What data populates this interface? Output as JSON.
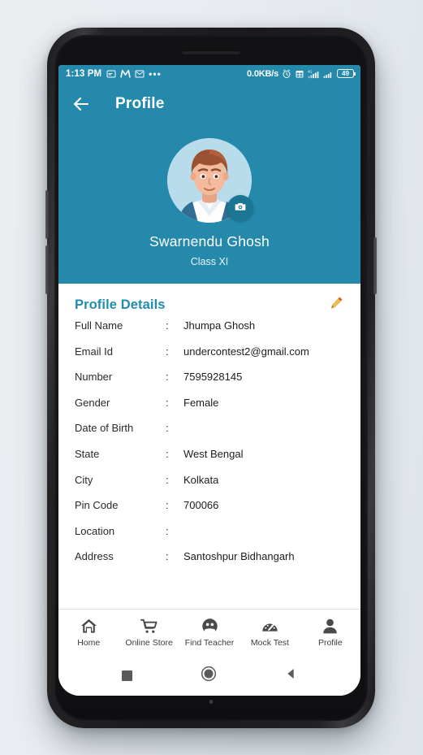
{
  "statusbar": {
    "time": "1:13 PM",
    "left_icons": [
      "message-icon",
      "m-app-icon",
      "gmail-icon",
      "overflow-dots-icon"
    ],
    "network_speed": "0.0KB/s",
    "right_icons": [
      "alarm-icon",
      "calendar-icon",
      "signal-4g-icon",
      "signal-icon"
    ],
    "battery_level": "49"
  },
  "appbar": {
    "back_label": "back-arrow",
    "title": "Profile"
  },
  "hero": {
    "avatar_alt": "user-avatar",
    "camera_button_label": "change-photo",
    "name": "Swarnendu Ghosh",
    "class": "Class XI"
  },
  "details": {
    "title": "Profile Details",
    "edit_label": "edit",
    "colon": ":",
    "rows": [
      {
        "label": "Full Name",
        "value": "Jhumpa Ghosh"
      },
      {
        "label": "Email Id",
        "value": "undercontest2@gmail.com"
      },
      {
        "label": "Number",
        "value": "7595928145"
      },
      {
        "label": "Gender",
        "value": "Female"
      },
      {
        "label": "Date of Birth",
        "value": ""
      },
      {
        "label": "State",
        "value": "West Bengal"
      },
      {
        "label": "City",
        "value": "Kolkata"
      },
      {
        "label": "Pin Code",
        "value": "700066"
      },
      {
        "label": "Location",
        "value": ""
      },
      {
        "label": "Address",
        "value": "Santoshpur Bidhangarh"
      }
    ]
  },
  "bottomnav": {
    "items": [
      {
        "label": "Home",
        "icon": "home-icon"
      },
      {
        "label": "Online Store",
        "icon": "shopping-cart-icon"
      },
      {
        "label": "Find Teacher",
        "icon": "teacher-face-icon"
      },
      {
        "label": "Mock Test",
        "icon": "speedometer-icon"
      },
      {
        "label": "Profile",
        "icon": "person-icon"
      }
    ]
  },
  "sysnav": {
    "recents_label": "recents",
    "home_label": "home",
    "back_label": "back"
  },
  "colors": {
    "accent_teal": "#2589ac",
    "title_teal": "#1f8cb0",
    "camera_badge": "#1b7694",
    "edit_pencil": "#f2c14e",
    "screen_bg": "#ffffff"
  }
}
